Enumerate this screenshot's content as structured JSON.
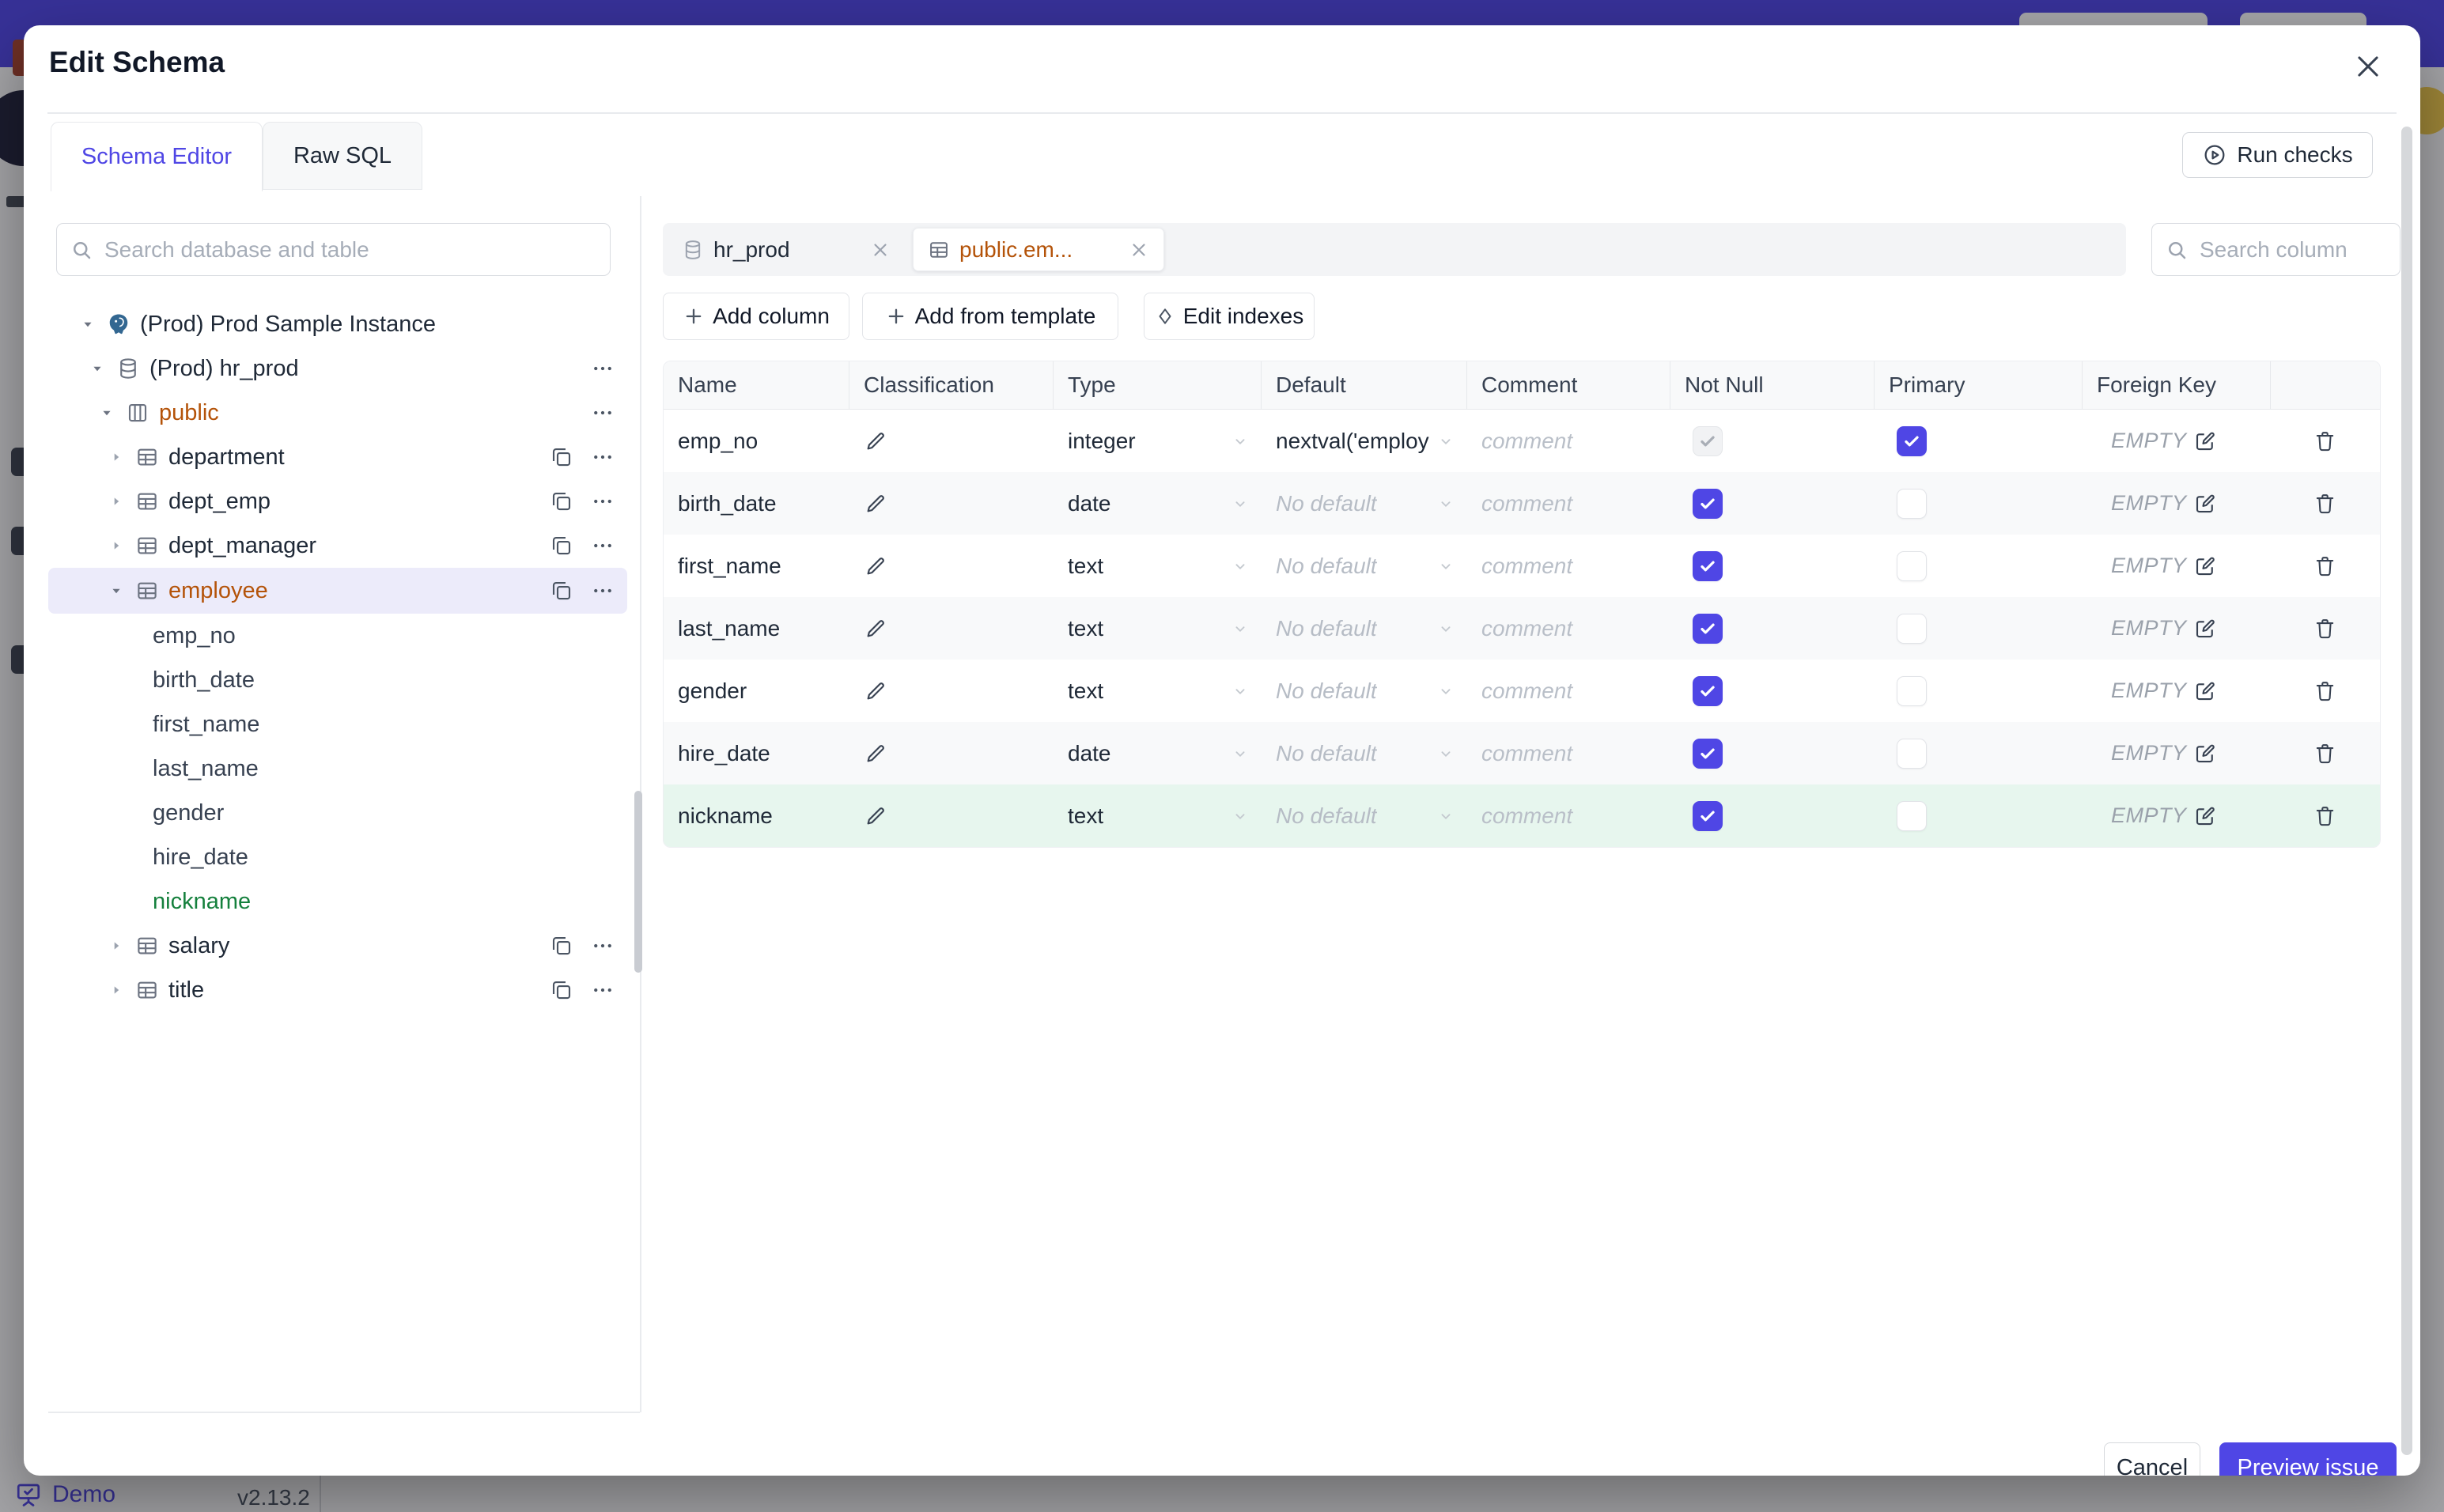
{
  "colors": {
    "accent": "#4f46e5",
    "topbar": "#4f46e5",
    "selected_table_text": "#b45309",
    "new_item_text": "#15803d",
    "new_row_bg": "#e7f6ee",
    "selected_row_bg": "#ecebfa"
  },
  "underlay": {
    "demo_label": "Demo",
    "version": "v2.13.2"
  },
  "modal": {
    "title": "Edit Schema",
    "tabs": [
      {
        "label": "Schema Editor",
        "state": "active"
      },
      {
        "label": "Raw SQL",
        "state": "inactive"
      }
    ],
    "run_checks_label": "Run checks"
  },
  "sidebar": {
    "search_placeholder": "Search database and table",
    "tree": {
      "instance": {
        "label": "(Prod) Prod Sample Instance"
      },
      "database": {
        "label": "(Prod) hr_prod"
      },
      "schema": {
        "label": "public",
        "state": "active"
      },
      "tables": [
        {
          "label": "department",
          "state": "normal"
        },
        {
          "label": "dept_emp",
          "state": "normal"
        },
        {
          "label": "dept_manager",
          "state": "normal"
        },
        {
          "label": "employee",
          "state": "selected"
        },
        {
          "label": "salary",
          "state": "normal"
        },
        {
          "label": "title",
          "state": "normal"
        }
      ],
      "employee_columns": [
        {
          "label": "emp_no",
          "state": "normal"
        },
        {
          "label": "birth_date",
          "state": "normal"
        },
        {
          "label": "first_name",
          "state": "normal"
        },
        {
          "label": "last_name",
          "state": "normal"
        },
        {
          "label": "gender",
          "state": "normal"
        },
        {
          "label": "hire_date",
          "state": "normal"
        },
        {
          "label": "nickname",
          "state": "new"
        }
      ]
    }
  },
  "editor": {
    "open_tabs": [
      {
        "label": "hr_prod",
        "state": "inactive"
      },
      {
        "label": "public.em...",
        "state": "active"
      }
    ],
    "search_placeholder": "Search column",
    "toolbar": {
      "add_column": "Add column",
      "add_from_template": "Add from template",
      "edit_indexes": "Edit indexes"
    },
    "table": {
      "headers": [
        "Name",
        "Classification",
        "Type",
        "Default",
        "Comment",
        "Not Null",
        "Primary",
        "Foreign Key"
      ],
      "rows": [
        {
          "name": "emp_no",
          "type": "integer",
          "default": "nextval('employ",
          "default_kind": "value",
          "comment": "comment",
          "not_null": "dis",
          "primary": "on",
          "foreign_key": "EMPTY",
          "state": "normal"
        },
        {
          "name": "birth_date",
          "type": "date",
          "default": "No default",
          "default_kind": "placeholder",
          "comment": "comment",
          "not_null": "on",
          "primary": "off",
          "foreign_key": "EMPTY",
          "state": "normal"
        },
        {
          "name": "first_name",
          "type": "text",
          "default": "No default",
          "default_kind": "placeholder",
          "comment": "comment",
          "not_null": "on",
          "primary": "off",
          "foreign_key": "EMPTY",
          "state": "normal"
        },
        {
          "name": "last_name",
          "type": "text",
          "default": "No default",
          "default_kind": "placeholder",
          "comment": "comment",
          "not_null": "on",
          "primary": "off",
          "foreign_key": "EMPTY",
          "state": "normal"
        },
        {
          "name": "gender",
          "type": "text",
          "default": "No default",
          "default_kind": "placeholder",
          "comment": "comment",
          "not_null": "on",
          "primary": "off",
          "foreign_key": "EMPTY",
          "state": "normal"
        },
        {
          "name": "hire_date",
          "type": "date",
          "default": "No default",
          "default_kind": "placeholder",
          "comment": "comment",
          "not_null": "on",
          "primary": "off",
          "foreign_key": "EMPTY",
          "state": "normal"
        },
        {
          "name": "nickname",
          "type": "text",
          "default": "No default",
          "default_kind": "placeholder",
          "comment": "comment",
          "not_null": "on",
          "primary": "off",
          "foreign_key": "EMPTY",
          "state": "new"
        }
      ]
    }
  },
  "footer": {
    "cancel_label": "Cancel",
    "preview_label": "Preview issue"
  }
}
